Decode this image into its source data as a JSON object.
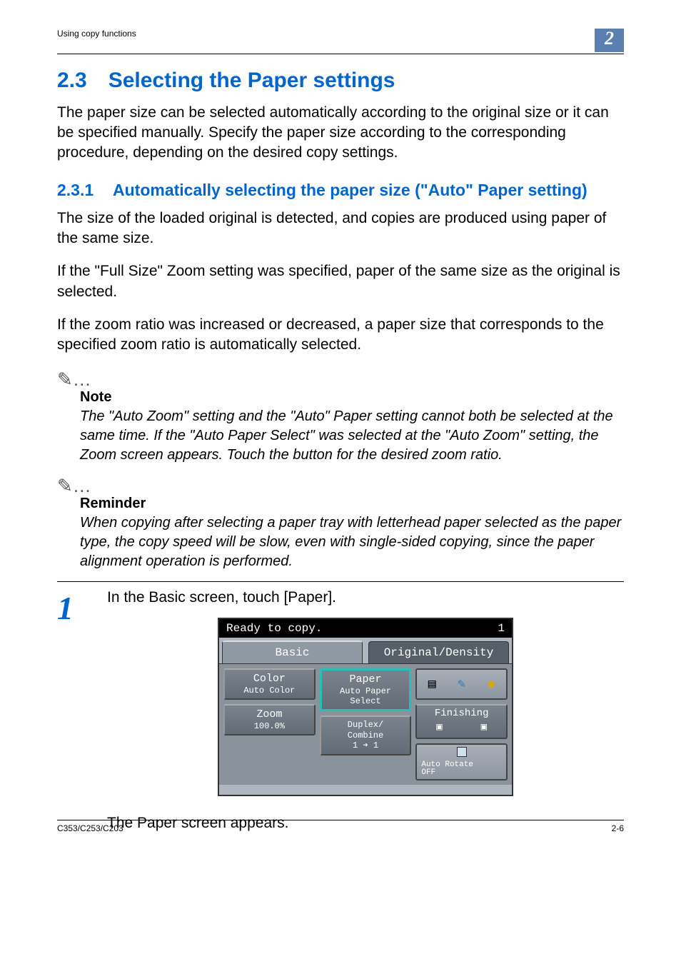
{
  "header": {
    "breadcrumb": "Using copy functions",
    "chapter": "2"
  },
  "section": {
    "num": "2.3",
    "title": "Selecting the Paper settings",
    "intro": "The paper size can be selected automatically according to the original size or it can be specified manually. Specify the paper size according to the corresponding procedure, depending on the desired copy settings."
  },
  "subsection": {
    "num": "2.3.1",
    "title": "Automatically selecting the paper size (\"Auto\" Paper setting)",
    "p1": "The size of the loaded original is detected, and copies are produced using paper of the same size.",
    "p2": "If the \"Full Size\" Zoom setting was specified, paper of the same size as the original is selected.",
    "p3": "If the zoom ratio was increased or decreased, a paper size that corresponds to the specified zoom ratio is automatically selected."
  },
  "note1": {
    "symbol": "✎…",
    "heading": "Note",
    "body": "The \"Auto Zoom\" setting and the \"Auto\" Paper setting cannot both be selected at the same time. If the \"Auto Paper Select\" was selected at the \"Auto Zoom\" setting, the Zoom screen appears. Touch the button for the desired zoom ratio."
  },
  "note2": {
    "symbol": "✎…",
    "heading": "Reminder",
    "body": "When copying after selecting a paper tray with letterhead paper selected as the paper type, the copy speed will be slow, even with single-sided copying, since the paper alignment operation is performed."
  },
  "step1": {
    "num": "1",
    "text": "In the Basic screen, touch [Paper].",
    "after": "The Paper screen appears."
  },
  "screenshot": {
    "status": "Ready to copy.",
    "count": "1",
    "tab_basic": "Basic",
    "tab_orig": "Original/Density",
    "color_label": "Color",
    "color_value": "Auto Color",
    "paper_label": "Paper",
    "paper_value": "Auto Paper\nSelect",
    "zoom_label": "Zoom",
    "zoom_value": "100.0%",
    "duplex_label": "Duplex/\nCombine",
    "duplex_value": "1 ➔ 1",
    "finishing_label": "Finishing",
    "rotate_label": "Auto Rotate\nOFF"
  },
  "footer": {
    "left": "C353/C253/C203",
    "right": "2-6"
  }
}
